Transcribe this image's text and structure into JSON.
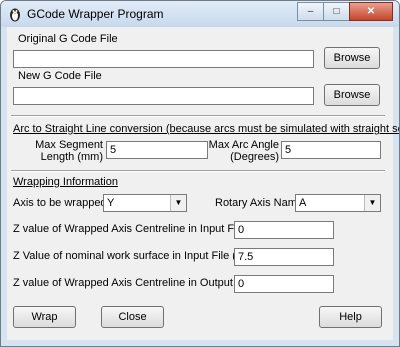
{
  "window": {
    "title": "GCode Wrapper Program",
    "controls": {
      "minimize": "–",
      "maximize": "□",
      "close": "✕"
    }
  },
  "files": {
    "original_label": "Original G Code File",
    "original_value": "",
    "new_label": "New G Code File",
    "new_value": "",
    "browse_label": "Browse"
  },
  "arc": {
    "heading": "Arc to Straight Line conversion (because arcs must be simulated with straight segments)",
    "max_segment_label": "Max Segment\nLength (mm)",
    "max_segment_value": "5",
    "max_arc_label": "Max Arc Angle\n(Degrees)",
    "max_arc_value": "5"
  },
  "wrap": {
    "heading": "Wrapping Information",
    "axis_label": "Axis to be wrapped",
    "axis_value": "Y",
    "rotary_label": "Rotary Axis Name",
    "rotary_value": "A",
    "z_centre_in_label": "Z value of Wrapped Axis Centreline in Input File (mm)",
    "z_centre_in_value": "0",
    "z_surface_label": "Z Value of nominal work surface in Input File (mm)",
    "z_surface_value": "7.5",
    "z_centre_out_label": "Z value of Wrapped Axis Centreline in Output File (mm)",
    "z_centre_out_value": "0"
  },
  "buttons": {
    "wrap": "Wrap",
    "close": "Close",
    "help": "Help"
  }
}
